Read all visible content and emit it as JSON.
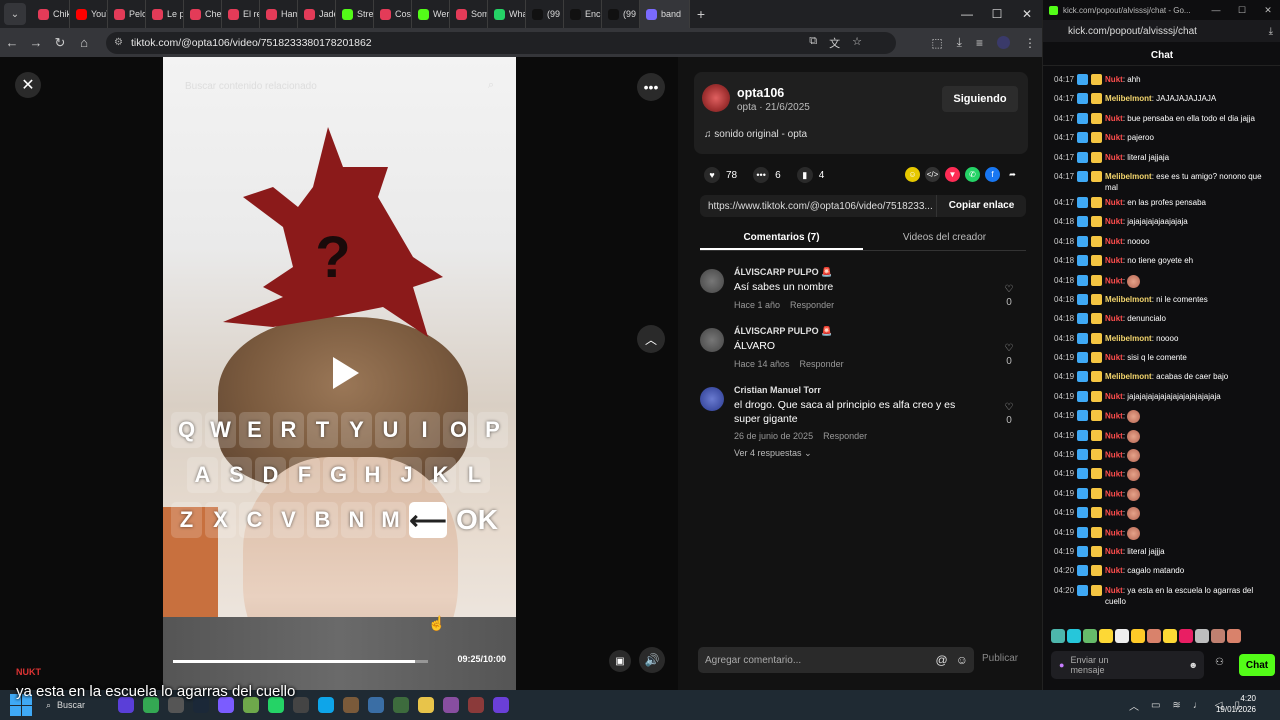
{
  "browser": {
    "tabs": [
      {
        "label": "Chik",
        "color": "#e33b58"
      },
      {
        "label": "YouT",
        "color": "#ff0000"
      },
      {
        "label": "Pelo",
        "color": "#e33b58"
      },
      {
        "label": "Le p",
        "color": "#e33b58"
      },
      {
        "label": "Che",
        "color": "#e33b58"
      },
      {
        "label": "El re",
        "color": "#e33b58"
      },
      {
        "label": "Ham",
        "color": "#e33b58"
      },
      {
        "label": "Jade",
        "color": "#e33b58"
      },
      {
        "label": "Strea",
        "color": "#53fc18"
      },
      {
        "label": "Cosc",
        "color": "#e33b58"
      },
      {
        "label": "Wer",
        "color": "#53fc18"
      },
      {
        "label": "Som",
        "color": "#e33b58"
      },
      {
        "label": "Wha",
        "color": "#25d366"
      },
      {
        "label": "(99",
        "color": "#111111"
      },
      {
        "label": "Encu",
        "color": "#111111"
      },
      {
        "label": "(99",
        "color": "#111111"
      },
      {
        "label": "band",
        "color": "#7a6aff"
      }
    ],
    "new_tab_label": "+",
    "url": "tiktok.com/@opta106/video/7518233380178201862"
  },
  "video": {
    "search_placeholder": "Buscar contenido relacionado",
    "keyboard": {
      "row1": [
        "Q",
        "W",
        "E",
        "R",
        "T",
        "Y",
        "U",
        "I",
        "O",
        "P"
      ],
      "row2": [
        "A",
        "S",
        "D",
        "F",
        "G",
        "H",
        "J",
        "K",
        "L"
      ],
      "row3": [
        "Z",
        "X",
        "C",
        "V",
        "B",
        "N",
        "M"
      ],
      "ok_label": "OK"
    },
    "progress_fraction": 0.95,
    "timecode": "09:25/10:00"
  },
  "post": {
    "username": "opta106",
    "meta": "opta · 21/6/2025",
    "follow_label": "Siguiendo",
    "music": "sonido original - opta",
    "likes": "78",
    "comments": "6",
    "saves": "4",
    "link": "https://www.tiktok.com/@opta106/video/7518233...",
    "copy_label": "Copiar enlace",
    "tab_comments": "Comentarios (7)",
    "tab_creator": "Videos del creador"
  },
  "comments": [
    {
      "author": "ÁLVISCARP PULPO 🚨",
      "text": "Así sabes un nombre",
      "time": "Hace 1 año",
      "reply": "Responder",
      "likes": "0"
    },
    {
      "author": "ÁLVISCARP PULPO 🚨",
      "text": "ÁLVARO",
      "time": "Hace 14 años",
      "reply": "Responder",
      "likes": "0"
    },
    {
      "author": "Cristian Manuel Torr",
      "text": "el drogo. Que saca al principio es alfa creo y es super gigante",
      "time": "26 de junio de 2025",
      "reply": "Responder",
      "likes": "0",
      "replies": "Ver 4 respuestas"
    }
  ],
  "comment_input": {
    "placeholder": "Agregar comentario...",
    "publish_label": "Publicar"
  },
  "chat": {
    "window_title": "kick.com/popout/alvisssj/chat - Go...",
    "url": "kick.com/popout/alvisssj/chat",
    "header": "Chat",
    "user_colors": {
      "Nukt": "#ff4d4d",
      "Melibelmont": "#f5d76e"
    },
    "messages": [
      {
        "time": "04:17",
        "user": "Nukt",
        "text": "ahh"
      },
      {
        "time": "04:17",
        "user": "Melibelmont",
        "text": "JAJAJAJAJJAJA"
      },
      {
        "time": "04:17",
        "user": "Nukt",
        "text": "bue pensaba en ella todo el dia jajja"
      },
      {
        "time": "04:17",
        "user": "Nukt",
        "text": "pajeroo"
      },
      {
        "time": "04:17",
        "user": "Nukt",
        "text": "literal jajjaja"
      },
      {
        "time": "04:17",
        "user": "Melibelmont",
        "text": "ese es tu amigo? nonono que mal"
      },
      {
        "time": "04:17",
        "user": "Nukt",
        "text": "en las profes pensaba"
      },
      {
        "time": "04:18",
        "user": "Nukt",
        "text": "jajajajajajaajajaja"
      },
      {
        "time": "04:18",
        "user": "Nukt",
        "text": "noooo"
      },
      {
        "time": "04:18",
        "user": "Nukt",
        "text": "no tiene goyete eh"
      },
      {
        "time": "04:18",
        "user": "Nukt",
        "text": "",
        "emote": true
      },
      {
        "time": "04:18",
        "user": "Melibelmont",
        "text": "ni le comentes"
      },
      {
        "time": "04:18",
        "user": "Nukt",
        "text": "denuncialo"
      },
      {
        "time": "04:18",
        "user": "Melibelmont",
        "text": "noooo"
      },
      {
        "time": "04:19",
        "user": "Nukt",
        "text": "sisi q le comente"
      },
      {
        "time": "04:19",
        "user": "Melibelmont",
        "text": "acabas de caer bajo"
      },
      {
        "time": "04:19",
        "user": "Nukt",
        "text": "jajajajajajajajajajajajajajaja"
      },
      {
        "time": "04:19",
        "user": "Nukt",
        "text": "",
        "emote": true
      },
      {
        "time": "04:19",
        "user": "Nukt",
        "text": "",
        "emote": true
      },
      {
        "time": "04:19",
        "user": "Nukt",
        "text": "",
        "emote": true
      },
      {
        "time": "04:19",
        "user": "Nukt",
        "text": "",
        "emote": true
      },
      {
        "time": "04:19",
        "user": "Nukt",
        "text": "",
        "emote": true
      },
      {
        "time": "04:19",
        "user": "Nukt",
        "text": "",
        "emote": true
      },
      {
        "time": "04:19",
        "user": "Nukt",
        "text": "",
        "emote": true
      },
      {
        "time": "04:19",
        "user": "Nukt",
        "text": "literal jajjja"
      },
      {
        "time": "04:20",
        "user": "Nukt",
        "text": "cagalo matando"
      },
      {
        "time": "04:20",
        "user": "Nukt",
        "text": "ya esta en la escuela lo agarras del cuello"
      }
    ],
    "input_placeholder": "Enviar un mensaje",
    "send_label": "Chat"
  },
  "overlay": {
    "caption_user": "NUKT",
    "caption": "ya esta en la escuela lo agarras del cuello"
  },
  "taskbar": {
    "search_label": "Buscar",
    "time": "4:20",
    "date": "19/01/2026"
  }
}
